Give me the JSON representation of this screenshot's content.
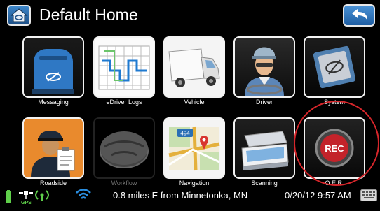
{
  "header": {
    "title": "Default Home"
  },
  "tiles": [
    {
      "label": "Messaging",
      "icon": "mailbox-icon"
    },
    {
      "label": "eDriver Logs",
      "icon": "log-grid-icon"
    },
    {
      "label": "Vehicle",
      "icon": "truck-icon"
    },
    {
      "label": "Driver",
      "icon": "driver-icon"
    },
    {
      "label": "System",
      "icon": "system-chip-icon"
    },
    {
      "label": "Roadside",
      "icon": "inspector-icon"
    },
    {
      "label": "Workflow",
      "icon": "workflow-disc-icon",
      "disabled": true
    },
    {
      "label": "Navigation",
      "icon": "map-icon",
      "road_sign": "494"
    },
    {
      "label": "Scanning",
      "icon": "scanner-icon"
    },
    {
      "label": "O.E.R.",
      "icon": "rec-button-icon",
      "badge": "REC"
    }
  ],
  "status": {
    "gps_label": "GPS",
    "location_text": "0.8 miles E from Minnetonka, MN",
    "datetime": "0/20/12 9:57 AM"
  },
  "colors": {
    "accent_blue": "#2a6fb5",
    "highlight_red": "#d6262b",
    "background": "#000000"
  }
}
